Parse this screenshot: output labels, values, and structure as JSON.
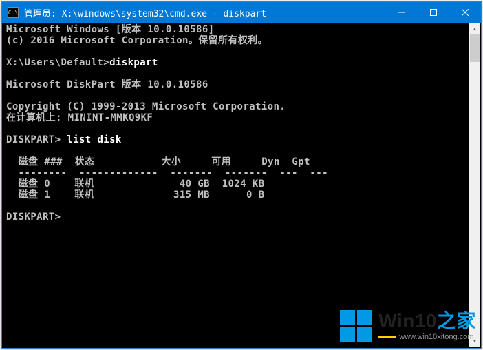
{
  "window": {
    "title": "管理员: X:\\windows\\system32\\cmd.exe - diskpart"
  },
  "terminal": {
    "line1": "Microsoft Windows [版本 10.0.10586]",
    "line2": "(c) 2016 Microsoft Corporation。保留所有权利。",
    "prompt1_path": "X:\\Users\\Default>",
    "prompt1_cmd": "diskpart",
    "line4": "Microsoft DiskPart 版本 10.0.10586",
    "line5": "Copyright (C) 1999-2013 Microsoft Corporation.",
    "line6": "在计算机上: MININT-MMKQ9KF",
    "prompt2_label": "DISKPART> ",
    "prompt2_cmd": "list disk",
    "table_header": "  磁盘 ###  状态           大小     可用     Dyn  Gpt",
    "table_divider": "  --------  -------------  -------  -------  ---  ---",
    "row0": "  磁盘 0    联机              40 GB  1024 KB",
    "row1": "  磁盘 1    联机             315 MB      0 B",
    "prompt3": "DISKPART> "
  },
  "watermark": {
    "brand_part1": "Win10",
    "brand_part2": "之家",
    "url": "www.win10xitong.com"
  }
}
